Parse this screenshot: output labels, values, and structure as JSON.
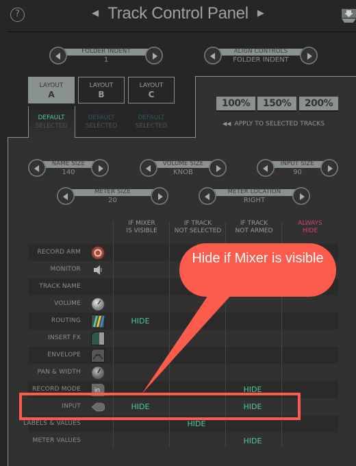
{
  "header": {
    "title": "Track Control Panel",
    "help_icon": "?",
    "prev_icon": "◀",
    "next_icon": "▶",
    "download_icon": "download-arrow"
  },
  "top_controls": [
    {
      "label": "FOLDER INDENT",
      "value": "1"
    },
    {
      "label": "ALIGN CONTROLS",
      "value": "FOLDER INDENT"
    }
  ],
  "layouts": [
    {
      "title": "LAYOUT",
      "letter": "A",
      "status_default": "DEFAULT",
      "status_selected": "SELECTED",
      "active": true
    },
    {
      "title": "LAYOUT",
      "letter": "B",
      "status_default": "DEFAULT",
      "status_selected": "SELECTED",
      "active": false
    },
    {
      "title": "LAYOUT",
      "letter": "C",
      "status_default": "DEFAULT",
      "status_selected": "SELECTED",
      "active": false
    }
  ],
  "scale_buttons": [
    "100%",
    "150%",
    "200%"
  ],
  "apply_label": "APPLY TO SELECTED TRACKS",
  "apply_icon": "◀◀",
  "size_controls": [
    {
      "label": "NAME SIZE",
      "value": "140"
    },
    {
      "label": "VOLUME SIZE",
      "value": "KNOB"
    },
    {
      "label": "INPUT SIZE",
      "value": "90"
    },
    {
      "label": "METER SIZE",
      "value": "20"
    },
    {
      "label": "METER LOCATION",
      "value": "RIGHT"
    }
  ],
  "columns": [
    {
      "line1": "IF MIXER",
      "line2": "IS VISIBLE"
    },
    {
      "line1": "IF TRACK",
      "line2": "NOT SELECTED"
    },
    {
      "line1": "IF TRACK",
      "line2": "NOT ARMED"
    },
    {
      "line1": "ALWAYS",
      "line2": "HIDE"
    }
  ],
  "rows": [
    {
      "name": "RECORD ARM",
      "icon": "record-arm-icon",
      "cells": [
        "",
        "",
        "",
        ""
      ]
    },
    {
      "name": "MONITOR",
      "icon": "speaker-icon",
      "cells": [
        "",
        "",
        "",
        ""
      ]
    },
    {
      "name": "TRACK NAME",
      "icon": "",
      "cells": [
        "",
        "",
        "",
        ""
      ]
    },
    {
      "name": "VOLUME",
      "icon": "knob-icon",
      "cells": [
        "",
        "",
        "",
        ""
      ]
    },
    {
      "name": "ROUTING",
      "icon": "routing-icon",
      "cells": [
        "HIDE",
        "",
        "",
        ""
      ]
    },
    {
      "name": "INSERT FX",
      "icon": "insert-fx-icon",
      "cells": [
        "",
        "",
        "",
        ""
      ]
    },
    {
      "name": "ENVELOPE",
      "icon": "envelope-icon",
      "cells": [
        "",
        "",
        "",
        ""
      ]
    },
    {
      "name": "PAN & WIDTH",
      "icon": "pan-knob-icon",
      "cells": [
        "",
        "",
        "",
        ""
      ]
    },
    {
      "name": "RECORD MODE",
      "icon": "record-mode-icon",
      "icon_text": "in",
      "cells": [
        "",
        "",
        "HIDE",
        ""
      ]
    },
    {
      "name": "INPUT",
      "icon": "input-icon",
      "cells": [
        "HIDE",
        "",
        "HIDE",
        ""
      ]
    },
    {
      "name": "LABELS & VALUES",
      "icon": "",
      "cells": [
        "",
        "HIDE",
        "",
        ""
      ]
    },
    {
      "name": "METER VALUES",
      "icon": "",
      "cells": [
        "",
        "",
        "HIDE",
        ""
      ]
    }
  ],
  "annotation": {
    "text": "Hide if Mixer is visible",
    "color": "#fd5b4b"
  },
  "colors": {
    "hide_text": "#4fc9a0",
    "always_hide": "#d4406f",
    "accent_grey": "#8a9290"
  }
}
